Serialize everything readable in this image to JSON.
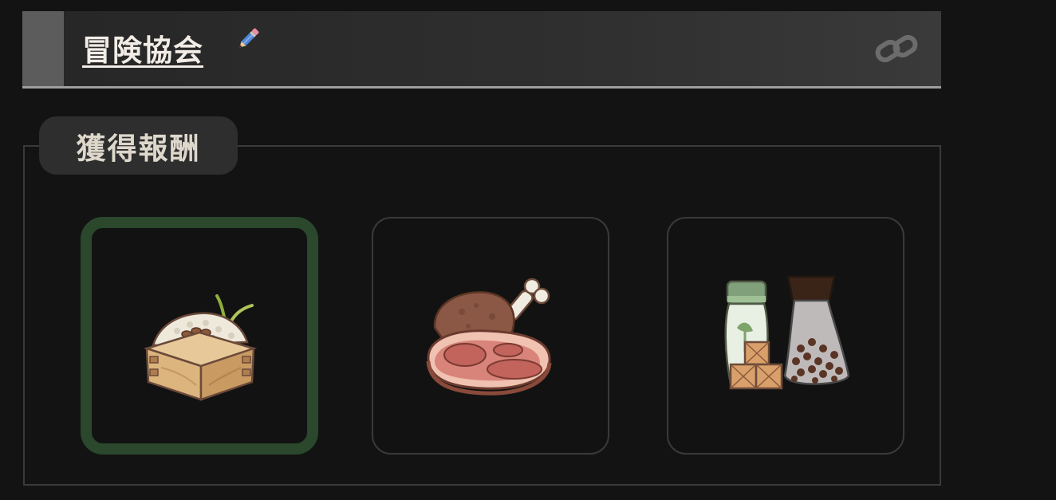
{
  "header": {
    "title": "冒険協会",
    "edit_icon": "pencil-icon",
    "link_icon": "link-icon",
    "colors": {
      "title": "#f1ece6",
      "underline": "#9e9e9e"
    }
  },
  "rewards": {
    "tab_label": "獲得報酬",
    "items": [
      {
        "icon": "rice-box-icon",
        "selected": true
      },
      {
        "icon": "meat-icon",
        "selected": false
      },
      {
        "icon": "spice-jars-icon",
        "selected": false
      }
    ],
    "colors": {
      "selected_border": "#2b472c",
      "slot_border": "#393939"
    }
  }
}
